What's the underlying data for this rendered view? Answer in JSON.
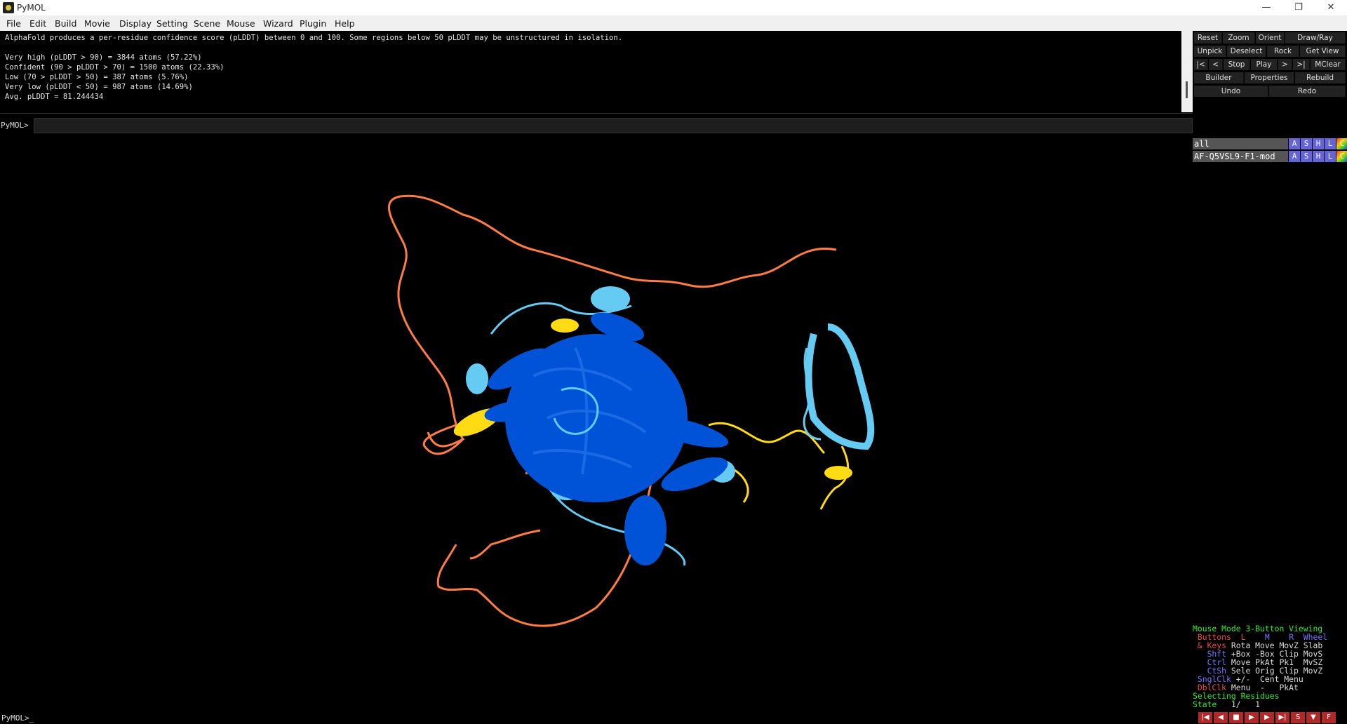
{
  "window": {
    "title": "PyMOL"
  },
  "menubar": {
    "items": [
      "File",
      "Edit",
      "Build",
      "Movie",
      "Display",
      "Setting",
      "Scene",
      "Mouse",
      "Wizard",
      "Plugin",
      "Help"
    ]
  },
  "output": {
    "lines": [
      "AlphaFold produces a per-residue confidence score (pLDDT) between 0 and 100. Some regions below 50 pLDDT may be unstructured in isolation.",
      "",
      "Very high (pLDDT > 90) = 3844 atoms (57.22%)",
      "Confident (90 > pLDDT > 70) = 1500 atoms (22.33%)",
      "Low (70 > pLDDT > 50) = 387 atoms (5.76%)",
      "Very low (pLDDT < 50) = 987 atoms (14.69%)",
      "Avg. pLDDT = 81.244434"
    ]
  },
  "command": {
    "prompt": "PyMOL>",
    "value": "",
    "bottom_prompt": "PyMOL>_"
  },
  "controls": {
    "row1": [
      "Reset",
      "Zoom",
      "Orient",
      "Draw/Ray"
    ],
    "row2": [
      "Unpick",
      "Deselect",
      "Rock",
      "Get View"
    ],
    "row3": [
      "|<",
      "<",
      "Stop",
      "Play",
      ">",
      ">|",
      "MClear"
    ],
    "row4": [
      "Builder",
      "Properties",
      "Rebuild"
    ],
    "row5": [
      "Undo",
      "Redo"
    ]
  },
  "objects": [
    {
      "name": "all",
      "buttons": [
        "A",
        "S",
        "H",
        "L",
        "C"
      ]
    },
    {
      "name": "AF-Q5VSL9-F1-mod",
      "buttons": [
        "A",
        "S",
        "H",
        "L",
        "C"
      ]
    }
  ],
  "mouse_info": {
    "mode": "Mouse Mode 3-Button Viewing",
    "buttons_line": {
      "label": "Buttons",
      "l": "L",
      "m": "M",
      "r": "R",
      "wheel": "Wheel"
    },
    "keys": [
      {
        "key": " & Keys",
        "vals": "Rota Move MovZ Slab"
      },
      {
        "key": "   Shft",
        "vals": "+Box -Box Clip MovS"
      },
      {
        "key": "   Ctrl",
        "vals": "Move PkAt Pk1  MvSZ"
      },
      {
        "key": "   CtSh",
        "vals": "Sele Orig Clip MovZ"
      },
      {
        "key": " SnglClk",
        "vals": "+/-  Cent Menu"
      },
      {
        "key": " DblClk",
        "vals": "Menu  -   PkAt"
      }
    ],
    "selecting": "Selecting Residues",
    "state": "State",
    "state_value": "1/   1"
  },
  "playback": [
    "|◀",
    "◀",
    "■",
    "▶",
    "▶",
    "▶|",
    "S",
    "▼",
    "F"
  ],
  "colors": {
    "very_high": "#0053d6",
    "confident": "#65cbf3",
    "low": "#ffdb13",
    "very_low": "#ff7d45"
  }
}
